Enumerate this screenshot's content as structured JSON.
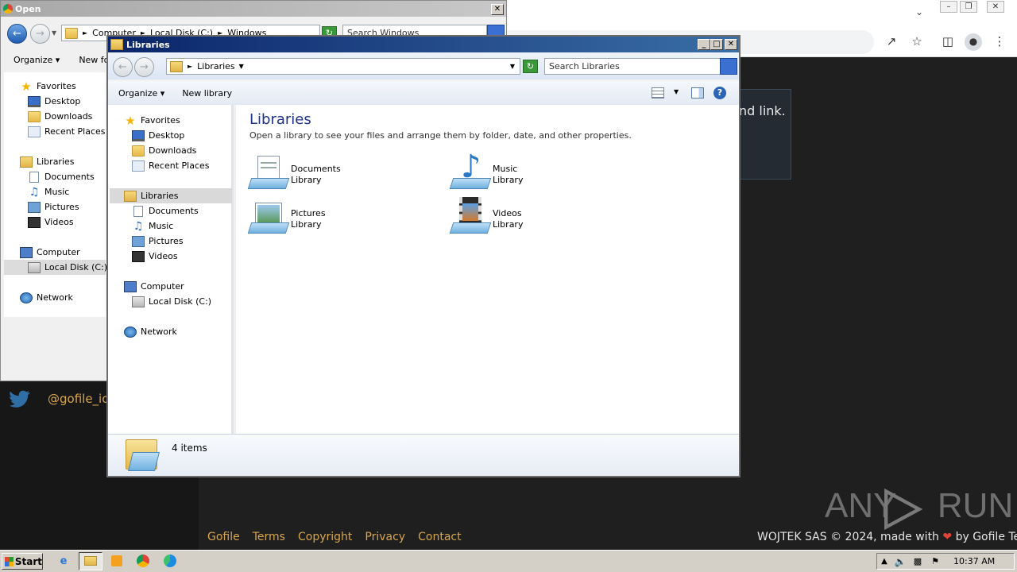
{
  "background_browser": {
    "card_text": "nd link.",
    "twitter_handle": "@gofile_io",
    "footer_links": [
      "Gofile",
      "Terms",
      "Copyright",
      "Privacy",
      "Contact"
    ],
    "footer_right_prefix": "WOJTEK SAS © 2024, made with",
    "footer_right_suffix": "by Gofile Team",
    "watermark": "ANY RUN"
  },
  "open_dialog": {
    "title": "Open",
    "address": [
      "Computer",
      "Local Disk (C:)",
      "Windows"
    ],
    "search_placeholder": "Search Windows",
    "commands": [
      "Organize",
      "New fol"
    ],
    "nav": {
      "favorites": "Favorites",
      "favorites_items": [
        "Desktop",
        "Downloads",
        "Recent Places"
      ],
      "libraries": "Libraries",
      "libraries_items": [
        "Documents",
        "Music",
        "Pictures",
        "Videos"
      ],
      "computer": "Computer",
      "computer_items": [
        "Local Disk (C:)"
      ],
      "network": "Network"
    }
  },
  "explorer": {
    "title": "Libraries",
    "address": "Libraries",
    "search_placeholder": "Search Libraries",
    "commands": {
      "organize": "Organize",
      "new_library": "New library"
    },
    "nav": {
      "favorites": "Favorites",
      "favorites_items": [
        "Desktop",
        "Downloads",
        "Recent Places"
      ],
      "libraries": "Libraries",
      "libraries_items": [
        "Documents",
        "Music",
        "Pictures",
        "Videos"
      ],
      "computer": "Computer",
      "computer_items": [
        "Local Disk (C:)"
      ],
      "network": "Network"
    },
    "content": {
      "heading": "Libraries",
      "subtitle": "Open a library to see your files and arrange them by folder, date, and other properties.",
      "items": [
        {
          "name": "Documents",
          "type": "Library",
          "icon": "documents-library-icon"
        },
        {
          "name": "Music",
          "type": "Library",
          "icon": "music-library-icon"
        },
        {
          "name": "Pictures",
          "type": "Library",
          "icon": "pictures-library-icon"
        },
        {
          "name": "Videos",
          "type": "Library",
          "icon": "videos-library-icon"
        }
      ]
    },
    "status": "4 items"
  },
  "taskbar": {
    "start_label": "Start",
    "clock": "10:37 AM"
  }
}
